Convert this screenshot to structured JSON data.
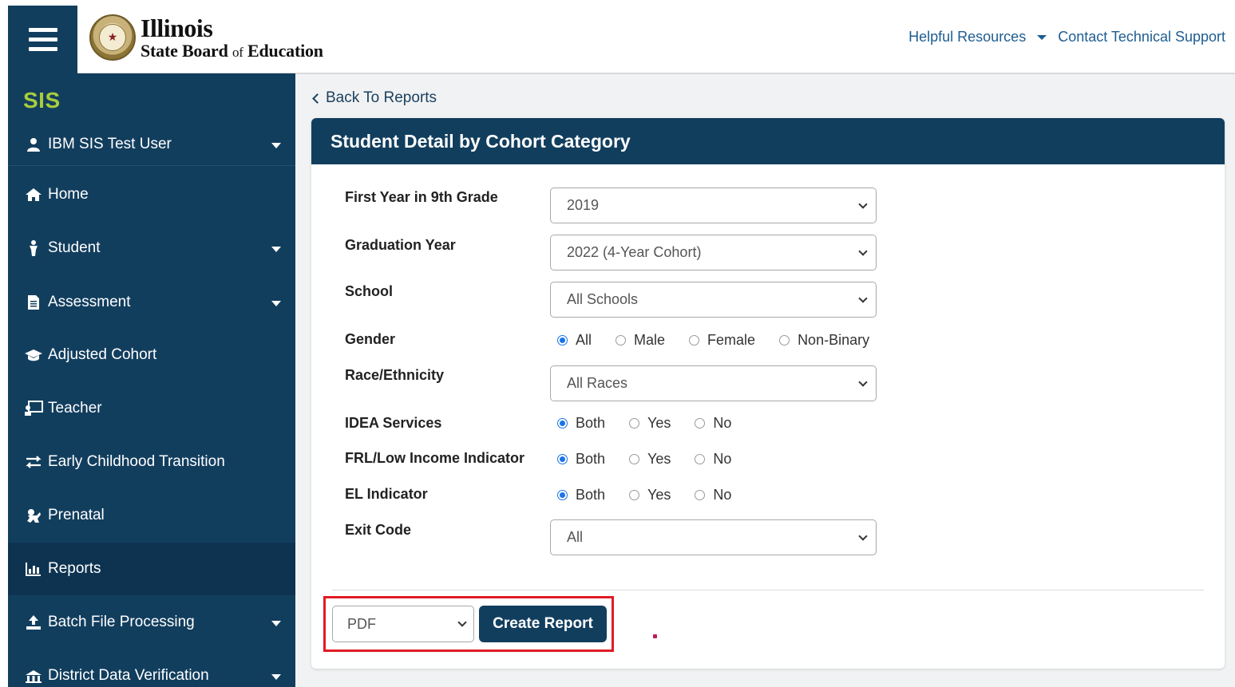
{
  "header": {
    "logo_line1": "Illinois",
    "logo_line2_a": "State Board",
    "logo_line2_of": "of",
    "logo_line2_b": "Education",
    "helpful_resources": "Helpful Resources",
    "contact_support": "Contact Technical Support"
  },
  "sidebar": {
    "app_name": "SIS",
    "user": "IBM SIS Test User",
    "items": [
      {
        "label": "Home",
        "icon": "home-icon"
      },
      {
        "label": "Student",
        "icon": "student-icon"
      },
      {
        "label": "Assessment",
        "icon": "assessment-icon"
      },
      {
        "label": "Adjusted Cohort",
        "icon": "graduation-cap-icon"
      },
      {
        "label": "Teacher",
        "icon": "teacher-board-icon"
      },
      {
        "label": "Early Childhood Transition",
        "icon": "exchange-arrows-icon"
      },
      {
        "label": "Prenatal",
        "icon": "baby-icon"
      },
      {
        "label": "Reports",
        "icon": "chart-icon"
      },
      {
        "label": "Batch File Processing",
        "icon": "upload-icon"
      },
      {
        "label": "District Data Verification",
        "icon": "verification-icon"
      }
    ]
  },
  "main": {
    "back_link": "Back To Reports",
    "panel_title": "Student Detail by Cohort Category",
    "fields": {
      "first_year_label": "First Year in 9th Grade",
      "first_year_value": "2019",
      "graduation_label": "Graduation Year",
      "graduation_value": "2022 (4-Year Cohort)",
      "school_label": "School",
      "school_value": "All Schools",
      "gender_label": "Gender",
      "gender_options": [
        "All",
        "Male",
        "Female",
        "Non-Binary"
      ],
      "race_label": "Race/Ethnicity",
      "race_value": "All Races",
      "idea_label": "IDEA Services",
      "idea_options": [
        "Both",
        "Yes",
        "No"
      ],
      "frl_label": "FRL/Low Income Indicator",
      "frl_options": [
        "Both",
        "Yes",
        "No"
      ],
      "el_label": "EL Indicator",
      "el_options": [
        "Both",
        "Yes",
        "No"
      ],
      "exit_label": "Exit Code",
      "exit_value": "All"
    },
    "format_value": "PDF",
    "create_button": "Create Report"
  },
  "colors": {
    "navy": "#123e5e",
    "sis_green": "#a7cd3c",
    "link_blue": "#1d5d91",
    "highlight_red": "#e01b24"
  }
}
